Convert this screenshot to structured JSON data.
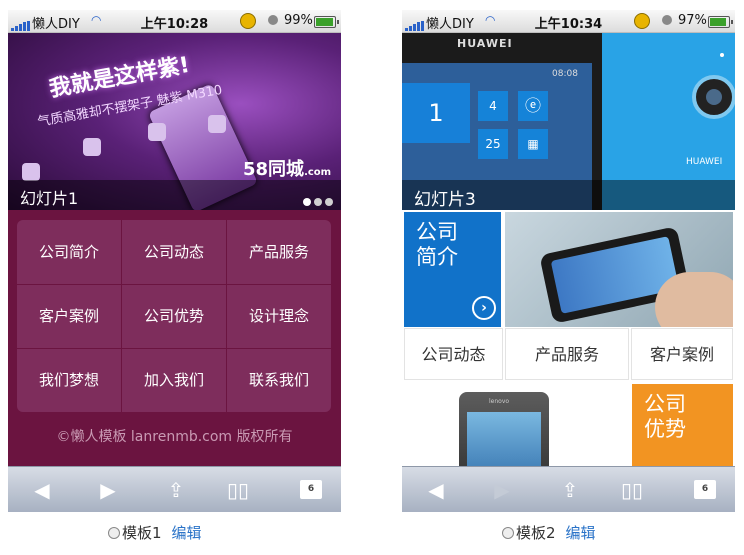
{
  "status_bar_1": {
    "carrier": "懒人DIY",
    "time": "上午10:28",
    "battery": "99%"
  },
  "status_bar_2": {
    "carrier": "懒人DIY",
    "time": "上午10:34",
    "battery": "97%"
  },
  "template1": {
    "slide": {
      "headline": "我就是这样紫!",
      "subline": "气质高雅却不摆架子 魅紫 M310",
      "brand": "58同城",
      "brand_suffix": ".com",
      "caption": "幻灯片1"
    },
    "menu": [
      {
        "label": "公司简介"
      },
      {
        "label": "公司动态"
      },
      {
        "label": "产品服务"
      },
      {
        "label": "客户案例"
      },
      {
        "label": "公司优势"
      },
      {
        "label": "设计理念"
      },
      {
        "label": "我们梦想"
      },
      {
        "label": "加入我们"
      },
      {
        "label": "联系我们"
      }
    ],
    "copyright": "©懒人模板 lanrenmb.com 版权所有"
  },
  "template2": {
    "slide": {
      "brand": "HUAWEI",
      "clock": "08:08",
      "tile_number_1": "1",
      "tile_number_2": "4",
      "tile_number_3": "25",
      "corner_brand": "HUAWEI",
      "caption": "幻灯片3"
    },
    "tiles": {
      "company_intro": "公司简介",
      "company_news": "公司动态",
      "products": "产品服务",
      "cases": "客户案例",
      "advantages": "公司优势",
      "phone_brand": "lenovo"
    }
  },
  "toolbar": {
    "tab_count": "6"
  },
  "captions": [
    {
      "name": "模板1",
      "edit": "编辑"
    },
    {
      "name": "模板2",
      "edit": "编辑"
    }
  ],
  "colors": {
    "t1_menu_bg": "#6b1440",
    "t1_cell_bg": "#7e2d5c",
    "t2_blue": "#1172c9",
    "t2_orange": "#f29422",
    "link": "#2a73c8"
  },
  "icons": [
    "signal-icon",
    "wifi-icon",
    "coin-icon",
    "lock-icon",
    "battery-icon",
    "back-arrow-icon",
    "forward-arrow-icon",
    "share-icon",
    "bookmarks-icon",
    "tabs-icon",
    "arrow-circle-icon"
  ]
}
